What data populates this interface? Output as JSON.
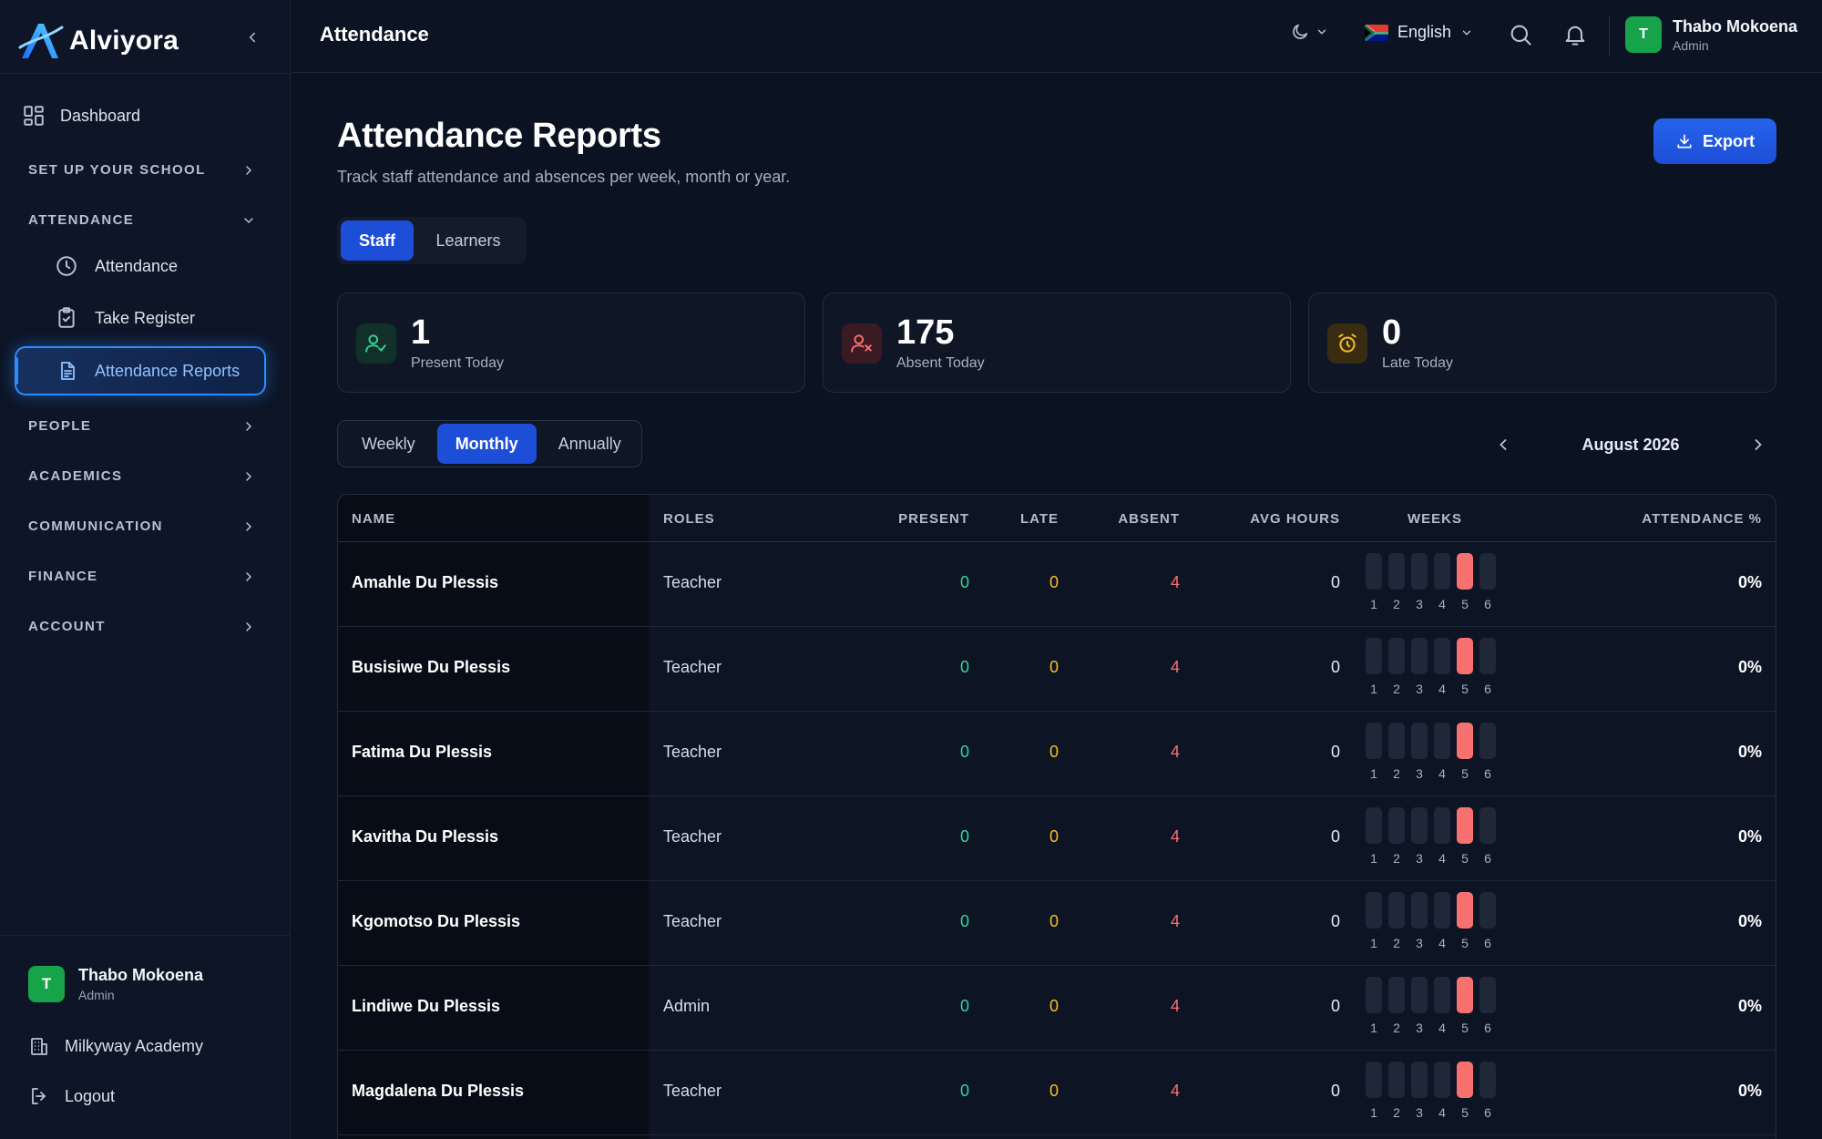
{
  "brand": {
    "name": "Alviyora"
  },
  "sidebar": {
    "dashboard": "Dashboard",
    "sections": {
      "setup": "SET UP YOUR SCHOOL",
      "attendance": "ATTENDANCE",
      "people": "PEOPLE",
      "academics": "ACADEMICS",
      "communication": "COMMUNICATION",
      "finance": "FINANCE",
      "account": "ACCOUNT"
    },
    "attendance_items": {
      "attendance": "Attendance",
      "take_register": "Take Register",
      "reports": "Attendance Reports"
    },
    "user": {
      "initial": "T",
      "name": "Thabo Mokoena",
      "role": "Admin"
    },
    "school": "Milkyway Academy",
    "logout": "Logout"
  },
  "topbar": {
    "title": "Attendance",
    "language": "English",
    "user": {
      "initial": "T",
      "name": "Thabo Mokoena",
      "role": "Admin"
    }
  },
  "page": {
    "title": "Attendance Reports",
    "subtitle": "Track staff attendance and absences per week, month or year.",
    "export_label": "Export",
    "tabs": {
      "staff": "Staff",
      "learners": "Learners"
    },
    "active_tab": "Staff"
  },
  "stats": {
    "present": {
      "value": "1",
      "label": "Present Today"
    },
    "absent": {
      "value": "175",
      "label": "Absent Today"
    },
    "late": {
      "value": "0",
      "label": "Late Today"
    }
  },
  "period": {
    "options": {
      "weekly": "Weekly",
      "monthly": "Monthly",
      "annually": "Annually"
    },
    "selected": "Monthly",
    "month_label": "August 2026"
  },
  "table": {
    "headers": {
      "name": "NAME",
      "roles": "ROLES",
      "present": "PRESENT",
      "late": "LATE",
      "absent": "ABSENT",
      "avg_hours": "AVG HOURS",
      "weeks": "WEEKS",
      "attendance_pct": "ATTENDANCE %"
    },
    "week_labels": [
      "1",
      "2",
      "3",
      "4",
      "5",
      "6"
    ],
    "rows": [
      {
        "name": "Amahle Du Plessis",
        "role": "Teacher",
        "present": "0",
        "late": "0",
        "absent": "4",
        "avg_hours": "0",
        "absent_week": 5,
        "pct": "0%"
      },
      {
        "name": "Busisiwe Du Plessis",
        "role": "Teacher",
        "present": "0",
        "late": "0",
        "absent": "4",
        "avg_hours": "0",
        "absent_week": 5,
        "pct": "0%"
      },
      {
        "name": "Fatima Du Plessis",
        "role": "Teacher",
        "present": "0",
        "late": "0",
        "absent": "4",
        "avg_hours": "0",
        "absent_week": 5,
        "pct": "0%"
      },
      {
        "name": "Kavitha Du Plessis",
        "role": "Teacher",
        "present": "0",
        "late": "0",
        "absent": "4",
        "avg_hours": "0",
        "absent_week": 5,
        "pct": "0%"
      },
      {
        "name": "Kgomotso Du Plessis",
        "role": "Teacher",
        "present": "0",
        "late": "0",
        "absent": "4",
        "avg_hours": "0",
        "absent_week": 5,
        "pct": "0%"
      },
      {
        "name": "Lindiwe Du Plessis",
        "role": "Admin",
        "present": "0",
        "late": "0",
        "absent": "4",
        "avg_hours": "0",
        "absent_week": 5,
        "pct": "0%"
      },
      {
        "name": "Magdalena Du Plessis",
        "role": "Teacher",
        "present": "0",
        "late": "0",
        "absent": "4",
        "avg_hours": "0",
        "absent_week": 5,
        "pct": "0%"
      }
    ]
  },
  "colors": {
    "accent": "#1d4ed8",
    "present": "#34d399",
    "late": "#fbbf24",
    "absent": "#f87171"
  }
}
